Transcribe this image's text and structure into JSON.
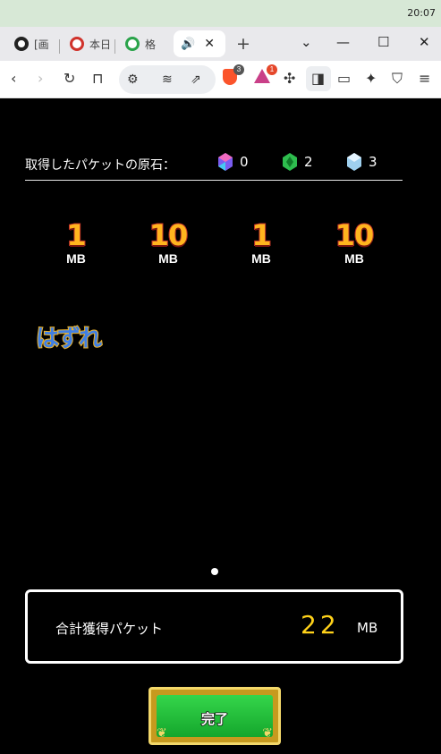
{
  "system": {
    "time": "20:07"
  },
  "tabs": [
    {
      "label": "[画",
      "favicon_color": "#222222"
    },
    {
      "label": "本日",
      "favicon_color": "#d0322b"
    },
    {
      "label": "格",
      "favicon_color": "#2aa34a"
    }
  ],
  "active_tab": {
    "speaker_icon": "speaker-icon",
    "close": "✕"
  },
  "toolbar": {
    "brave_badge": "3",
    "rewards_badge": "1"
  },
  "game": {
    "stones_label": "取得したパケットの原石：",
    "stones": [
      {
        "name": "rainbow-gem",
        "value": "0",
        "color": "#7a5cf0"
      },
      {
        "name": "green-gem",
        "value": "2",
        "color": "#2ebd4e"
      },
      {
        "name": "crystal-gem",
        "value": "3",
        "color": "#9fd0ef"
      }
    ],
    "packets": [
      {
        "num": "1",
        "unit": "MB"
      },
      {
        "num": "10",
        "unit": "MB"
      },
      {
        "num": "1",
        "unit": "MB"
      },
      {
        "num": "10",
        "unit": "MB"
      }
    ],
    "miss_text": "はずれ",
    "total": {
      "label": "合計獲得パケット",
      "value": "22",
      "unit": "MB"
    },
    "done_button": "完了"
  }
}
